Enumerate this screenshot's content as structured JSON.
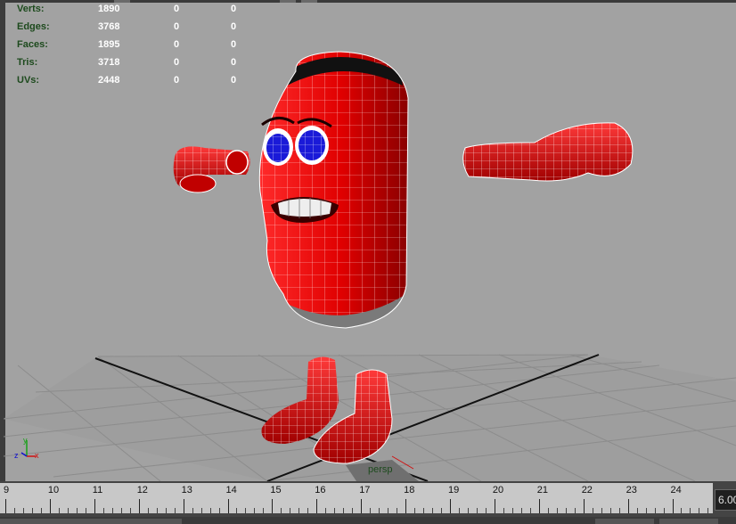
{
  "hud": {
    "rows": [
      {
        "label": "Verts:",
        "v1": "1890",
        "v2": "0",
        "v3": "0"
      },
      {
        "label": "Edges:",
        "v1": "3768",
        "v2": "0",
        "v3": "0"
      },
      {
        "label": "Faces:",
        "v1": "1895",
        "v2": "0",
        "v3": "0"
      },
      {
        "label": "Tris:",
        "v1": "3718",
        "v2": "0",
        "v3": "0"
      },
      {
        "label": "UVs:",
        "v1": "2448",
        "v2": "0",
        "v3": "0"
      }
    ]
  },
  "viewport": {
    "camera_label": "persp",
    "axis": {
      "x": "x",
      "y": "y",
      "z": "z"
    }
  },
  "timeline": {
    "ticks": [
      "9",
      "10",
      "11",
      "12",
      "13",
      "14",
      "15",
      "16",
      "17",
      "18",
      "19",
      "20",
      "21",
      "22",
      "23",
      "24"
    ],
    "current_frame": "6.00"
  },
  "colors": {
    "viewport_bg": "#a2a2a2",
    "model_red": "#d40000",
    "wire": "#ffffff",
    "eye_blue": "#1a1ad8",
    "hud_label": "#1d4a1d"
  }
}
